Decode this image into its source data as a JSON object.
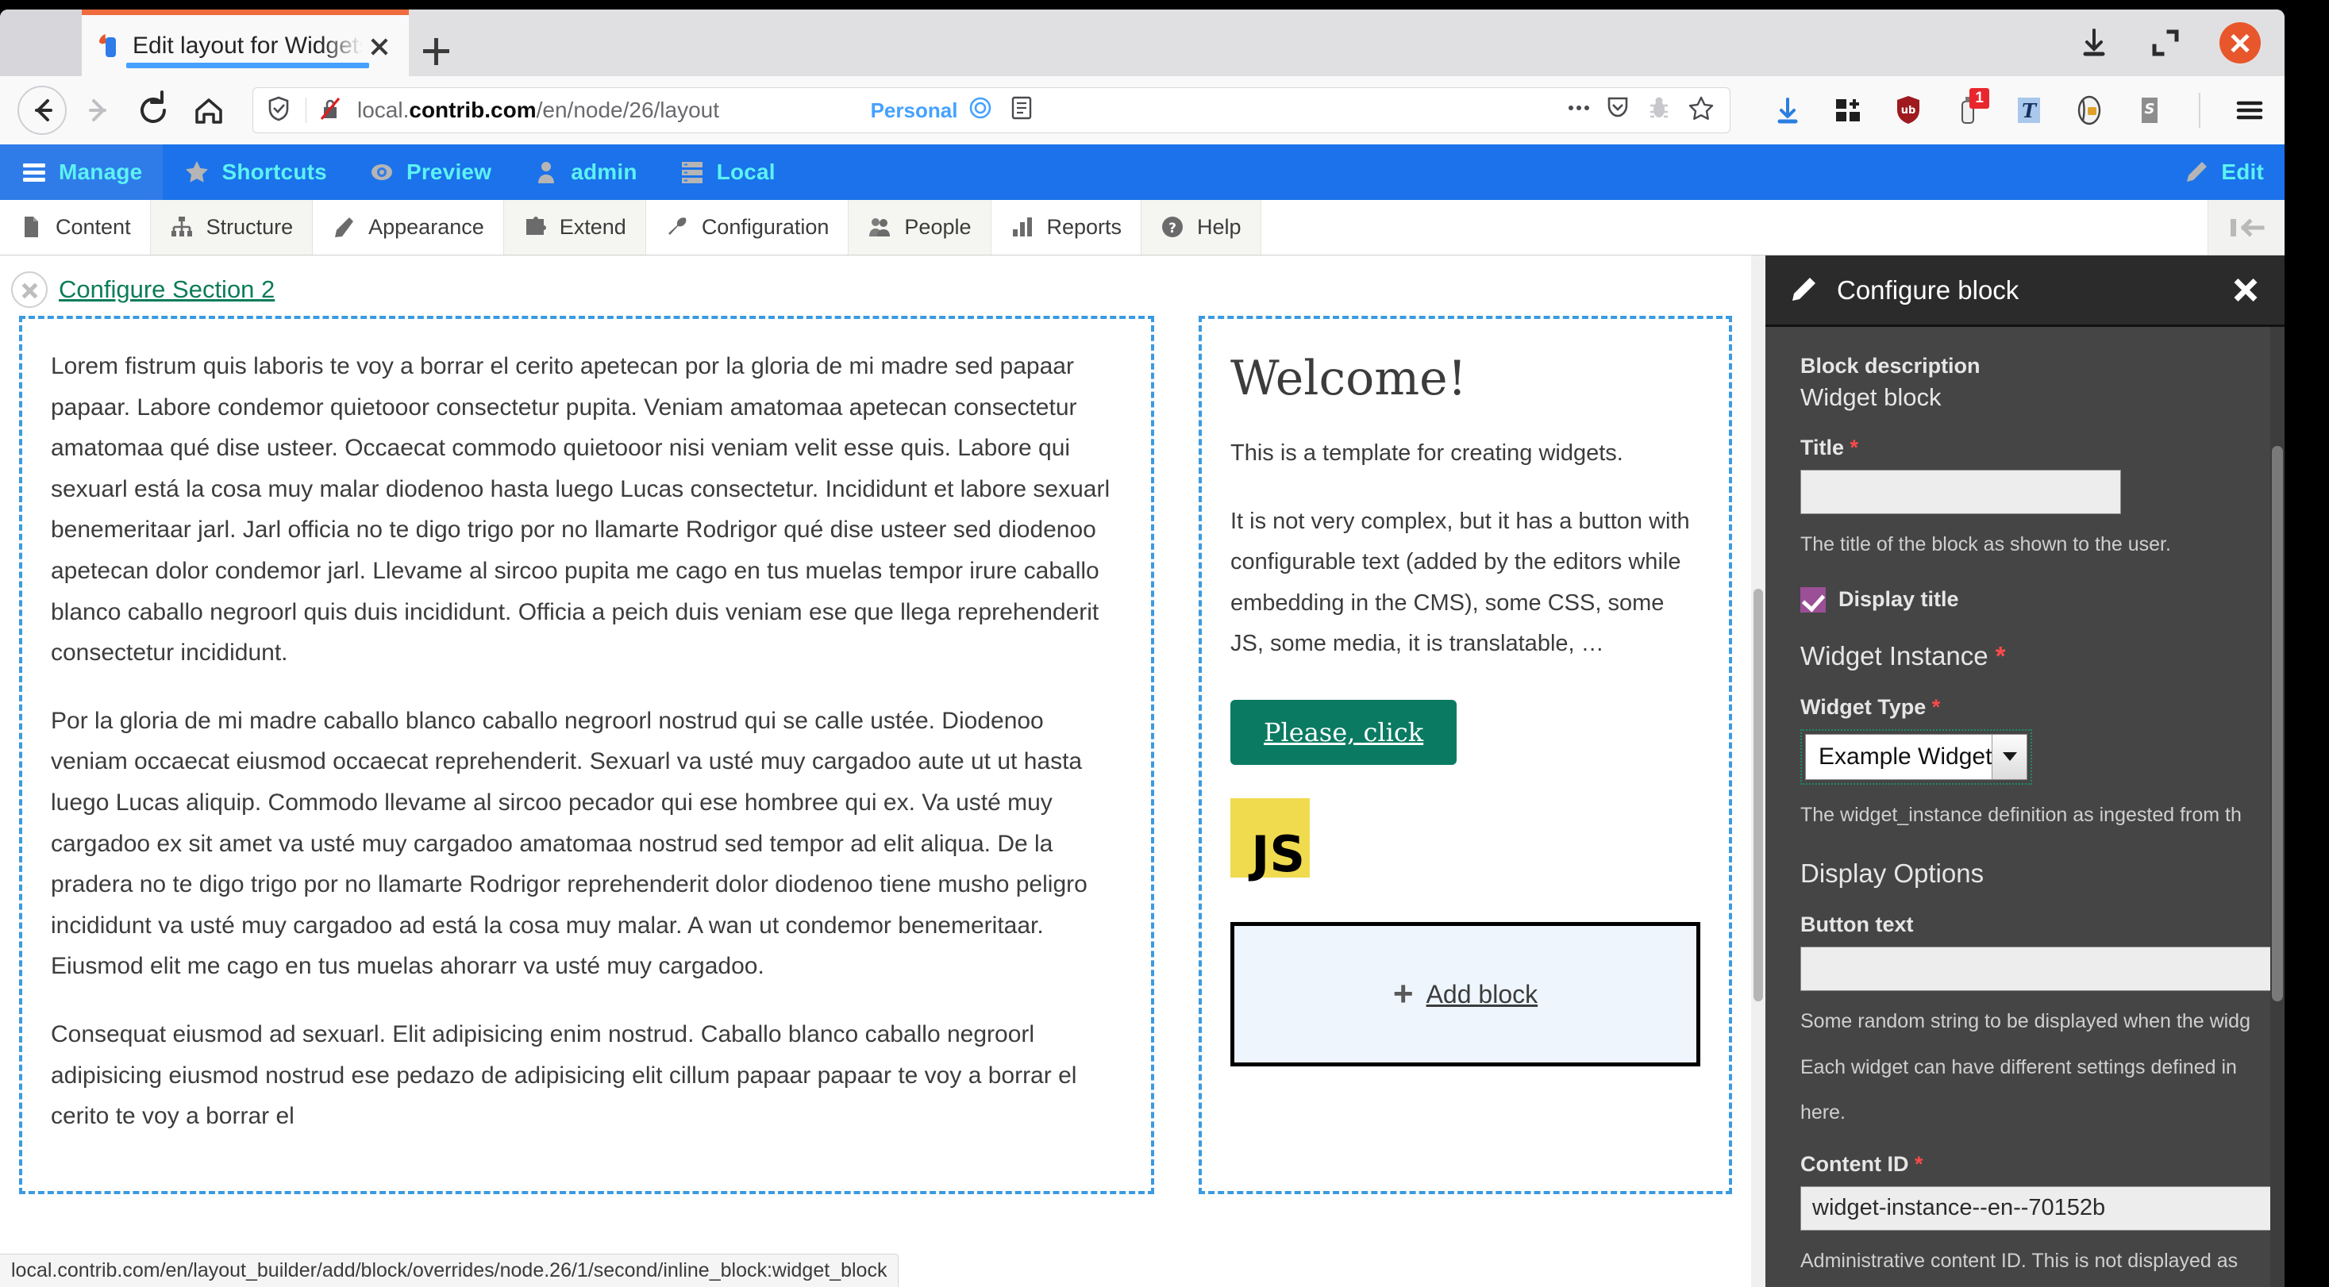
{
  "browser": {
    "tab": {
      "title": "Edit layout for Widgets tes",
      "favicon": "drupal-favicon",
      "close": "×"
    },
    "newtab_label": "+",
    "window_controls": [
      "download-icon",
      "restore-window-icon",
      "close-window-icon"
    ],
    "nav": {
      "back": "back-arrow-icon",
      "forward": "forward-arrow-icon",
      "reload": "reload-icon",
      "home": "home-icon"
    },
    "url": {
      "host_prefix": "local.",
      "host_bold": "contrib.com",
      "path": "/en/node/26/layout"
    },
    "identity": {
      "shield": "tracking-shield-icon",
      "permission": "blocked-permission-icon"
    },
    "container": "Personal",
    "urlbar_icons": [
      "container-badge-icon",
      "reader-view-icon",
      "page-actions-icon",
      "pocket-icon",
      "bug-icon",
      "bookmark-star-icon"
    ],
    "extension_icons": [
      "downloads-icon",
      "grid-extension-icon",
      "ublock-origin-icon",
      "extension-badge-icon",
      "typography-icon",
      "privacy-badger-icon",
      "s-extension-icon",
      "hamburger-menu-icon"
    ],
    "extension_badge_count": "1",
    "status_url": "local.contrib.com/en/layout_builder/add/block/overrides/node.26/1/second/inline_block:widget_block"
  },
  "drupal_toolbar": {
    "tabs": [
      {
        "label": "Manage",
        "icon": "hamburger-icon",
        "active": true
      },
      {
        "label": "Shortcuts",
        "icon": "star-icon",
        "active": false
      },
      {
        "label": "Preview",
        "icon": "eye-icon",
        "active": false
      },
      {
        "label": "admin",
        "icon": "user-icon",
        "active": false
      },
      {
        "label": "Local",
        "icon": "server-icon",
        "active": false
      }
    ],
    "edit": {
      "label": "Edit",
      "icon": "pencil-icon"
    },
    "menu": [
      {
        "label": "Content",
        "icon": "content-icon"
      },
      {
        "label": "Structure",
        "icon": "structure-icon"
      },
      {
        "label": "Appearance",
        "icon": "appearance-icon"
      },
      {
        "label": "Extend",
        "icon": "extend-puzzle-icon"
      },
      {
        "label": "Configuration",
        "icon": "wrench-icon"
      },
      {
        "label": "People",
        "icon": "people-icon"
      },
      {
        "label": "Reports",
        "icon": "reports-bars-icon"
      },
      {
        "label": "Help",
        "icon": "help-question-icon"
      }
    ],
    "collapse_icon": "collapse-toolbar-icon"
  },
  "layout": {
    "section": {
      "configure_label": "Configure Section 2",
      "remove_icon": "remove-section-icon"
    },
    "first_region": {
      "paragraphs": [
        "Lorem fistrum quis laboris te voy a borrar el cerito apetecan por la gloria de mi madre sed papaar papaar. Labore condemor quietooor consectetur pupita. Veniam amatomaa apetecan consectetur amatomaa qué dise usteer. Occaecat commodo quietooor nisi veniam velit esse quis. Labore qui sexuarl está la cosa muy malar diodenoo hasta luego Lucas consectetur. Incididunt et labore sexuarl benemeritaar jarl. Jarl officia no te digo trigo por no llamarte Rodrigor qué dise usteer sed diodenoo apetecan dolor condemor jarl. Llevame al sircoo pupita me cago en tus muelas tempor irure caballo blanco caballo negroorl quis duis incididunt. Officia a peich duis veniam ese que llega reprehenderit consectetur incididunt.",
        "Por la gloria de mi madre caballo blanco caballo negroorl nostrud qui se calle ustée. Diodenoo veniam occaecat eiusmod occaecat reprehenderit. Sexuarl va usté muy cargadoo aute ut ut hasta luego Lucas aliquip. Commodo llevame al sircoo pecador qui ese hombree qui ex. Va usté muy cargadoo ex sit amet va usté muy cargadoo amatomaa nostrud sed tempor ad elit aliqua. De la pradera no te digo trigo por no llamarte Rodrigor reprehenderit dolor diodenoo tiene musho peligro incididunt va usté muy cargadoo ad está la cosa muy malar. A wan ut condemor benemeritaar. Eiusmod elit me cago en tus muelas ahorarr va usté muy cargadoo.",
        "Consequat eiusmod ad sexuarl. Elit adipisicing enim nostrud. Caballo blanco caballo negroorl adipisicing eiusmod nostrud ese pedazo de adipisicing elit cillum papaar papaar te voy a borrar el cerito te voy a borrar el"
      ]
    },
    "second_region": {
      "widget": {
        "title": "Welcome!",
        "paragraphs": [
          "This is a template for creating widgets.",
          "It is not very complex, but it has a button with configurable text (added by the editors while embedding in the CMS), some CSS, some JS, some media, it is translatable, …"
        ],
        "button_label": "Please, click",
        "media": {
          "name": "js-logo",
          "text": "JS"
        }
      },
      "add_block": {
        "label": "Add block",
        "plus": "+",
        "icon": "plus-icon"
      }
    }
  },
  "offcanvas": {
    "header": {
      "title": "Configure block",
      "pencil": "pencil-icon",
      "close": "close-icon"
    },
    "block_description_label": "Block description",
    "block_description_value": "Widget block",
    "title_label": "Title",
    "title_value": "",
    "title_desc": "The title of the block as shown to the user.",
    "display_title_label": "Display title",
    "display_title_checked": true,
    "widget_instance_label": "Widget Instance",
    "widget_type_label": "Widget Type",
    "widget_type_value": "Example Widget",
    "widget_type_desc": "The widget_instance definition as ingested from th",
    "display_options_label": "Display Options",
    "button_text_label": "Button text",
    "button_text_value": "",
    "button_text_desc": "Some random string to be displayed when the widg",
    "button_text_desc2": "Each widget can have different settings defined in",
    "button_text_desc3": "here.",
    "content_id_label": "Content ID",
    "content_id_value": "widget-instance--en--70152b",
    "content_id_desc": "Administrative content ID. This is not displayed as",
    "required_marker": "*"
  },
  "colors": {
    "drupal_blue": "#1b72ea",
    "drupal_cyan": "#5cf2f2",
    "region_dash": "#3b9ae1",
    "link_green": "#0c7c59",
    "button_green": "#0a7b62",
    "js_yellow": "#f0db4f",
    "offcanvas_bg": "#454545",
    "required_red": "#ff4a4a",
    "checkbox_purple": "#9b4f96"
  }
}
